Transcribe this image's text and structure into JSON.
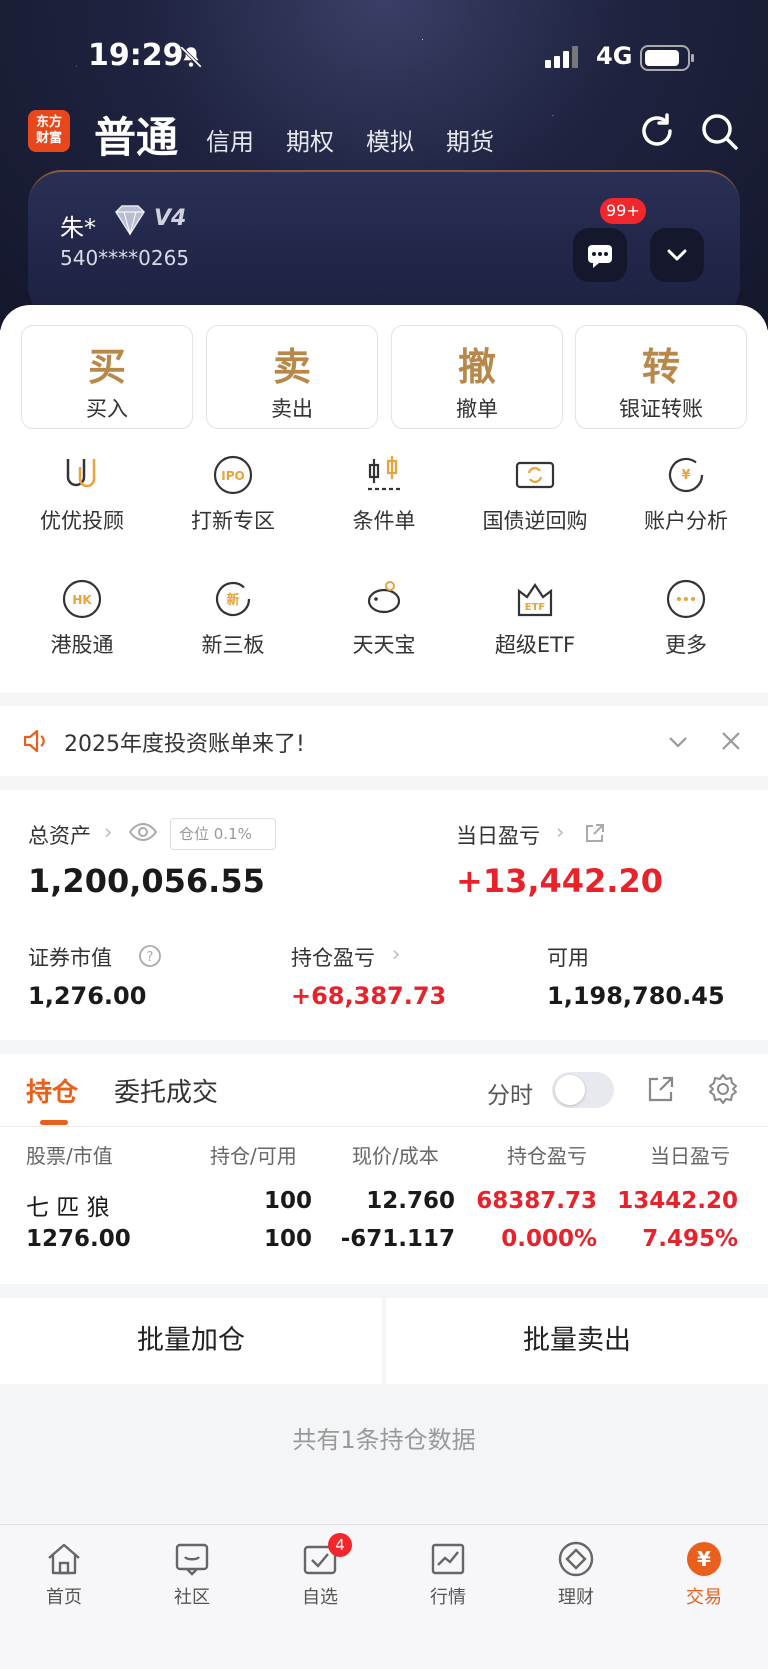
{
  "status_bar": {
    "time": "19:29",
    "network": "4G"
  },
  "top_nav": {
    "logo_text": "东方\n财富",
    "active_mode": "普通",
    "modes": [
      "信用",
      "期权",
      "模拟",
      "期货"
    ]
  },
  "account": {
    "name": "朱*",
    "level": "V4",
    "account_no": "540****0265",
    "message_badge": "99+"
  },
  "quick_actions": [
    {
      "char": "买",
      "label": "买入"
    },
    {
      "char": "卖",
      "label": "卖出"
    },
    {
      "char": "撤",
      "label": "撤单"
    },
    {
      "char": "转",
      "label": "银证转账"
    }
  ],
  "functions": [
    {
      "label": "优优投顾",
      "icon": "uu-advisor-icon"
    },
    {
      "label": "打新专区",
      "icon": "ipo-icon"
    },
    {
      "label": "条件单",
      "icon": "condition-order-icon"
    },
    {
      "label": "国债逆回购",
      "icon": "repo-icon"
    },
    {
      "label": "账户分析",
      "icon": "account-analysis-icon"
    },
    {
      "label": "港股通",
      "icon": "hk-icon"
    },
    {
      "label": "新三板",
      "icon": "neeq-icon"
    },
    {
      "label": "天天宝",
      "icon": "piggy-bank-icon"
    },
    {
      "label": "超级ETF",
      "icon": "etf-icon"
    },
    {
      "label": "更多",
      "icon": "more-icon"
    }
  ],
  "notice": {
    "text": "2025年度投资账单来了!"
  },
  "assets": {
    "total_label": "总资产",
    "position_tag": "仓位 0.1%",
    "total_value": "1,200,056.55",
    "daily_pl_label": "当日盈亏",
    "daily_pl_value": "+13,442.20",
    "market_value_label": "证券市值",
    "market_value": "1,276.00",
    "holding_pl_label": "持仓盈亏",
    "holding_pl_value": "+68,387.73",
    "available_label": "可用",
    "available_value": "1,198,780.45"
  },
  "holdings": {
    "tabs": [
      "持仓",
      "委托成交"
    ],
    "toggle_label": "分时",
    "toggle_on": false,
    "columns": [
      "股票/市值",
      "持仓/可用",
      "现价/成本",
      "持仓盈亏",
      "当日盈亏"
    ],
    "rows": [
      {
        "name": "七 匹 狼",
        "market_value": "1276.00",
        "position": "100",
        "available": "100",
        "price": "12.760",
        "cost": "-671.117",
        "holding_pl": "68387.73",
        "holding_pl_pct": "0.000%",
        "daily_pl": "13442.20",
        "daily_pl_pct": "7.495%"
      }
    ]
  },
  "batch": {
    "add": "批量加仓",
    "sell": "批量卖出"
  },
  "summary": "共有1条持仓数据",
  "bottom_nav": [
    {
      "label": "首页",
      "icon": "home-icon"
    },
    {
      "label": "社区",
      "icon": "community-icon"
    },
    {
      "label": "自选",
      "icon": "watchlist-icon",
      "badge": "4"
    },
    {
      "label": "行情",
      "icon": "market-icon"
    },
    {
      "label": "理财",
      "icon": "finance-icon"
    },
    {
      "label": "交易",
      "icon": "trade-icon"
    }
  ],
  "colors": {
    "accent": "#e8601c",
    "up_red": "#e8222b",
    "gold": "#b8884b"
  }
}
